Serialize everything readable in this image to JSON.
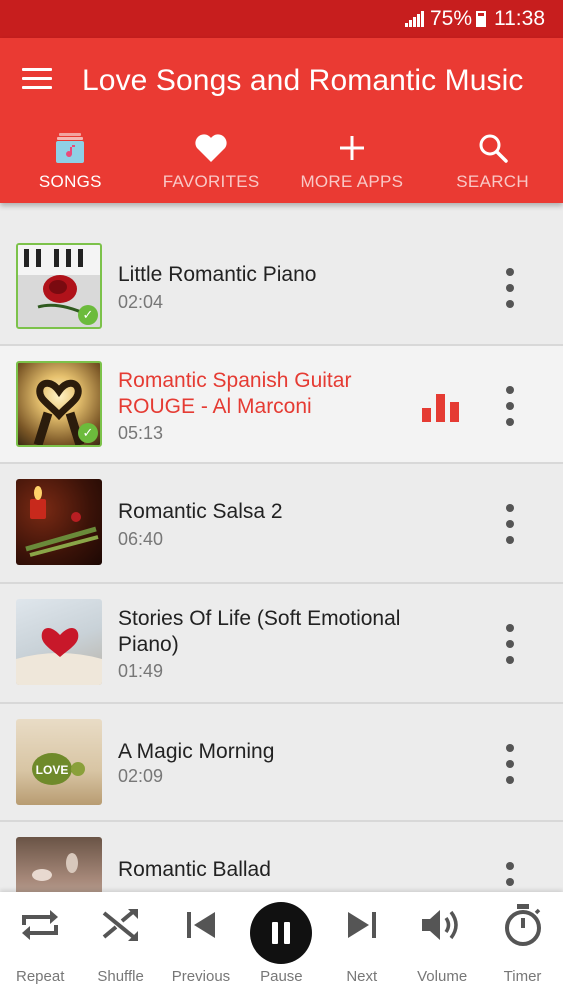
{
  "status_bar": {
    "battery": "75%",
    "time": "11:38"
  },
  "app_bar": {
    "title": "Love Songs and Romantic Music"
  },
  "tabs": [
    {
      "label": "SONGS",
      "icon": "music-library-icon",
      "active": true
    },
    {
      "label": "FAVORITES",
      "icon": "heart-icon",
      "active": false
    },
    {
      "label": "MORE APPS",
      "icon": "plus-icon",
      "active": false
    },
    {
      "label": "SEARCH",
      "icon": "search-icon",
      "active": false
    }
  ],
  "songs": [
    {
      "title": "Little Romantic Piano",
      "duration": "02:04",
      "downloaded": true,
      "playing": false
    },
    {
      "title": "Romantic Spanish Guitar ROUGE - Al Marconi",
      "duration": "05:13",
      "downloaded": true,
      "playing": true
    },
    {
      "title": "Romantic Salsa 2",
      "duration": "06:40",
      "downloaded": false,
      "playing": false
    },
    {
      "title": "Stories Of Life (Soft Emotional Piano)",
      "duration": "01:49",
      "downloaded": false,
      "playing": false
    },
    {
      "title": "A Magic Morning",
      "duration": "02:09",
      "downloaded": false,
      "playing": false
    },
    {
      "title": "Romantic Ballad",
      "duration": "",
      "downloaded": false,
      "playing": false
    }
  ],
  "thumb_texts": {
    "love_stone": "LOVE"
  },
  "player": {
    "controls": [
      {
        "label": "Repeat",
        "icon": "repeat-icon"
      },
      {
        "label": "Shuffle",
        "icon": "shuffle-icon"
      },
      {
        "label": "Previous",
        "icon": "previous-icon"
      },
      {
        "label": "Pause",
        "icon": "pause-icon"
      },
      {
        "label": "Next",
        "icon": "next-icon"
      },
      {
        "label": "Volume",
        "icon": "volume-icon"
      },
      {
        "label": "Timer",
        "icon": "timer-icon"
      }
    ]
  },
  "colors": {
    "status_bar": "#c71e1e",
    "app_bar": "#ea3a33",
    "accent": "#e53b33",
    "list_bg": "#ececec",
    "check": "#6cbb3c"
  }
}
